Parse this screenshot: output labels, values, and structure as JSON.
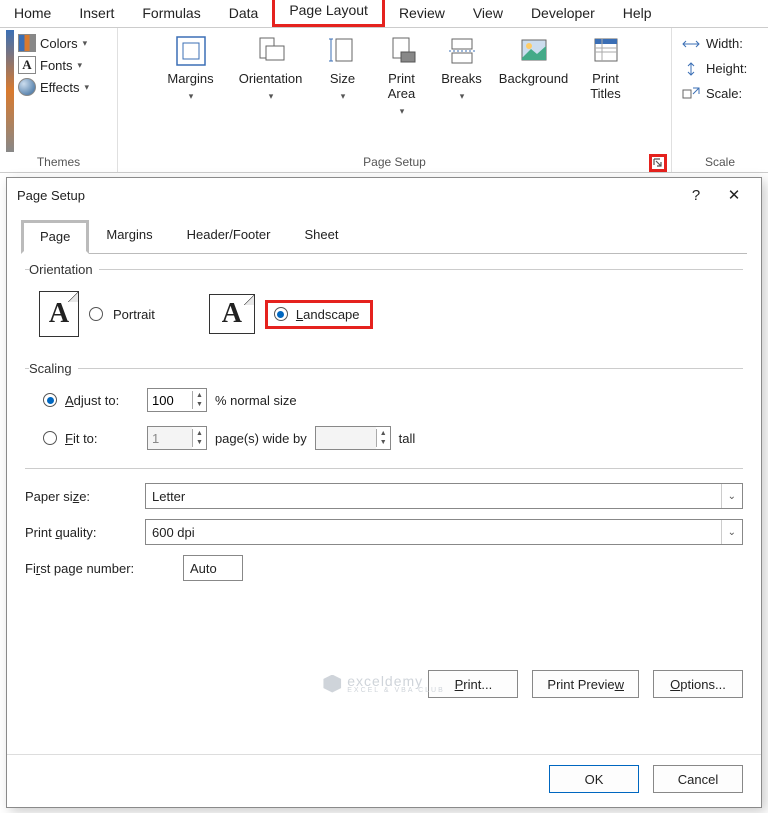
{
  "ribbon": {
    "tabs": [
      "Home",
      "Insert",
      "Formulas",
      "Data",
      "Page Layout",
      "Review",
      "View",
      "Developer",
      "Help"
    ],
    "active_tab": "Page Layout",
    "themes": {
      "colors": "Colors",
      "fonts": "Fonts",
      "effects": "Effects",
      "label": "Themes"
    },
    "page_setup": {
      "margins": "Margins",
      "orientation": "Orientation",
      "size": "Size",
      "print_area": "Print\nArea",
      "breaks": "Breaks",
      "background": "Background",
      "print_titles": "Print\nTitles",
      "label": "Page Setup"
    },
    "scale_to_fit": {
      "width": "Width:",
      "height": "Height:",
      "scale": "Scale:",
      "label": "Scale"
    }
  },
  "dialog": {
    "title": "Page Setup",
    "help": "?",
    "close": "✕",
    "tabs": {
      "page": "Page",
      "margins": "Margins",
      "header_footer": "Header/Footer",
      "sheet": "Sheet"
    },
    "orientation": {
      "legend": "Orientation",
      "portrait": "Portrait",
      "landscape": "Landscape",
      "selected": "landscape"
    },
    "scaling": {
      "legend": "Scaling",
      "adjust_to": "Adjust to:",
      "adjust_value": "100",
      "adjust_suffix": "% normal size",
      "fit_to": "Fit to:",
      "fit_wide": "1",
      "fit_mid": "page(s) wide by",
      "fit_tall_value": "",
      "fit_suffix": "tall",
      "selected": "adjust"
    },
    "paper_size": {
      "label": "Paper size:",
      "value": "Letter"
    },
    "print_quality": {
      "label": "Print quality:",
      "value": "600 dpi"
    },
    "first_page": {
      "label": "First page number:",
      "value": "Auto"
    },
    "buttons": {
      "print": "Print...",
      "print_preview": "Print Preview",
      "options": "Options...",
      "ok": "OK",
      "cancel": "Cancel"
    }
  },
  "watermark": {
    "brand": "exceldemy",
    "tag": "EXCEL & VBA CLUB"
  }
}
